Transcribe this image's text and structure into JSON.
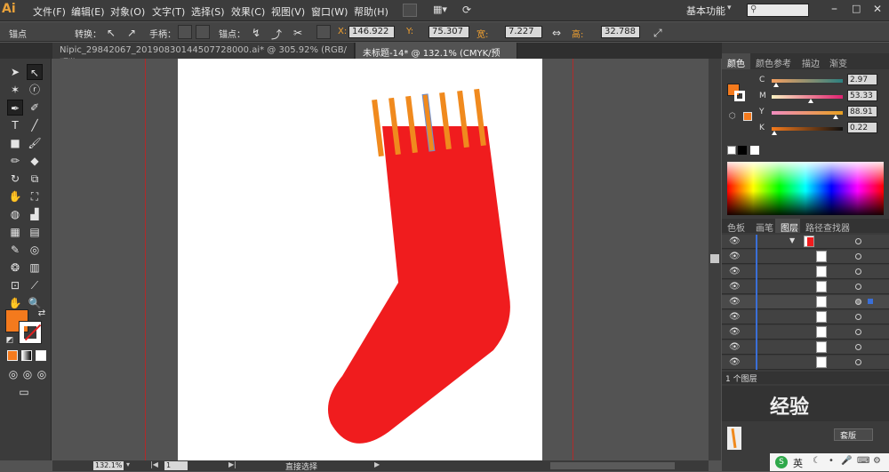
{
  "menubar": {
    "logo": "Ai",
    "items": [
      "文件(F)",
      "编辑(E)",
      "对象(O)",
      "文字(T)",
      "选择(S)",
      "效果(C)",
      "视图(V)",
      "窗口(W)",
      "帮助(H)"
    ],
    "workspace": "基本功能"
  },
  "control": {
    "anchor_label": "锚点",
    "convert_label": "转换：",
    "handle_label": "手柄：",
    "anchor2_label": "锚点：",
    "x_label": "X:",
    "x_value": "146.922",
    "y_label": "Y:",
    "y_value": "75.307",
    "w_label": "宽:",
    "w_value": "7.227",
    "h_label": "高:",
    "h_value": "32.788"
  },
  "tabs": [
    {
      "label": "Nipic_29842067_20190830144507728000.ai* @ 305.92% (RGB/预览)",
      "active": false
    },
    {
      "label": "未标题-14* @ 132.1% (CMYK/预览)",
      "active": true
    }
  ],
  "color_panel": {
    "tabs": [
      "颜色",
      "颜色参考",
      "描边",
      "渐变"
    ],
    "fill_color": "#f47a1d",
    "channels": [
      {
        "label": "C",
        "value": "2.97",
        "pct": 0.03,
        "gradient": "#2b8080"
      },
      {
        "label": "M",
        "value": "53.33",
        "pct": 0.53,
        "gradient": "#e02070"
      },
      {
        "label": "Y",
        "value": "88.91",
        "pct": 0.89,
        "gradient": "#e8d820"
      },
      {
        "label": "K",
        "value": "0.22",
        "pct": 0.0,
        "gradient": "#101010"
      }
    ]
  },
  "layers_panel": {
    "tabs": [
      "色板",
      "画笔",
      "图层",
      "路径查找器"
    ],
    "footer": "1 个图层"
  },
  "artwork": {
    "sock_color": "#f01c1e",
    "stripe_color": "#f08a1e"
  },
  "status": {
    "zoom": "132.1%",
    "page": "1",
    "tool": "直接选择"
  },
  "taskbar": {
    "ime": "英"
  },
  "watermark_partial": "经验",
  "preview_button": "套版"
}
